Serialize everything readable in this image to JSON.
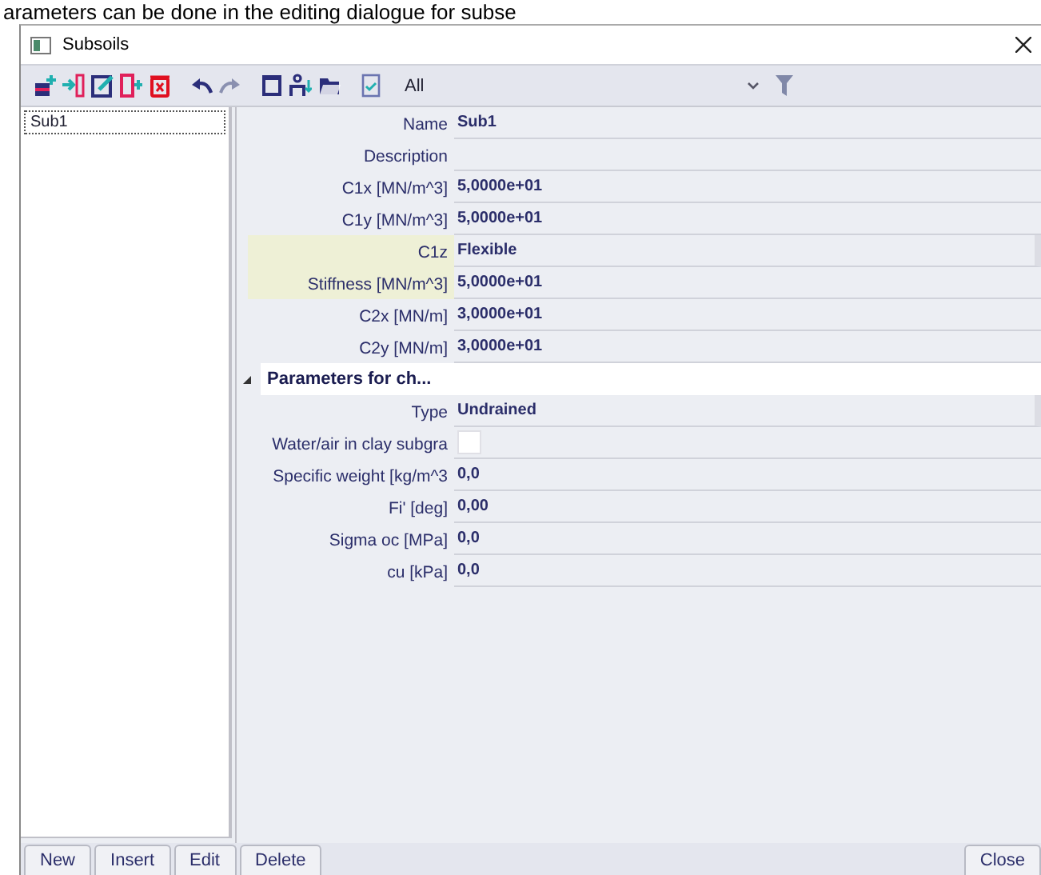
{
  "caption": "arameters can be done in the editing dialogue for subse",
  "window": {
    "title": "Subsoils"
  },
  "toolbar": {
    "filter": "All"
  },
  "list": {
    "items": [
      {
        "label": "Sub1",
        "selected": true
      }
    ]
  },
  "properties": [
    {
      "kind": "text",
      "label": "Name",
      "value": "Sub1",
      "highlighted": false
    },
    {
      "kind": "text",
      "label": "Description",
      "highlighted": false
    },
    {
      "kind": "text",
      "label": "C1x [MN/m^3]",
      "value": "5,0000e+01",
      "highlighted": false
    },
    {
      "kind": "text",
      "label": "C1y [MN/m^3]",
      "value": "5,0000e+01",
      "highlighted": false
    },
    {
      "kind": "dropdown",
      "label": "C1z",
      "value": "Flexible",
      "highlighted": true
    },
    {
      "kind": "text",
      "label": "Stiffness [MN/m^3]",
      "value": "5,0000e+01",
      "highlighted": true
    },
    {
      "kind": "text",
      "label": "C2x [MN/m]",
      "value": "3,0000e+01",
      "highlighted": false
    },
    {
      "kind": "text",
      "label": "C2y [MN/m]",
      "value": "3,0000e+01",
      "highlighted": false
    },
    {
      "kind": "section",
      "label": "Parameters for ch...",
      "expanded": true
    },
    {
      "kind": "dropdown",
      "label": "Type",
      "value": "Undrained",
      "highlighted": false
    },
    {
      "kind": "checkbox",
      "label": "Water/air in clay subgra",
      "checked": false,
      "highlighted": false
    },
    {
      "kind": "text",
      "label": "Specific weight [kg/m^3",
      "value": "0,0",
      "highlighted": false
    },
    {
      "kind": "text",
      "label": "Fi' [deg]",
      "value": "0,00",
      "highlighted": false
    },
    {
      "kind": "text",
      "label": "Sigma oc [MPa]",
      "value": "0,0",
      "highlighted": false
    },
    {
      "kind": "text",
      "label": "cu [kPa]",
      "value": "0,0",
      "highlighted": false
    }
  ],
  "buttons": [
    "New",
    "Insert",
    "Edit",
    "Delete"
  ],
  "close_button": "Close"
}
